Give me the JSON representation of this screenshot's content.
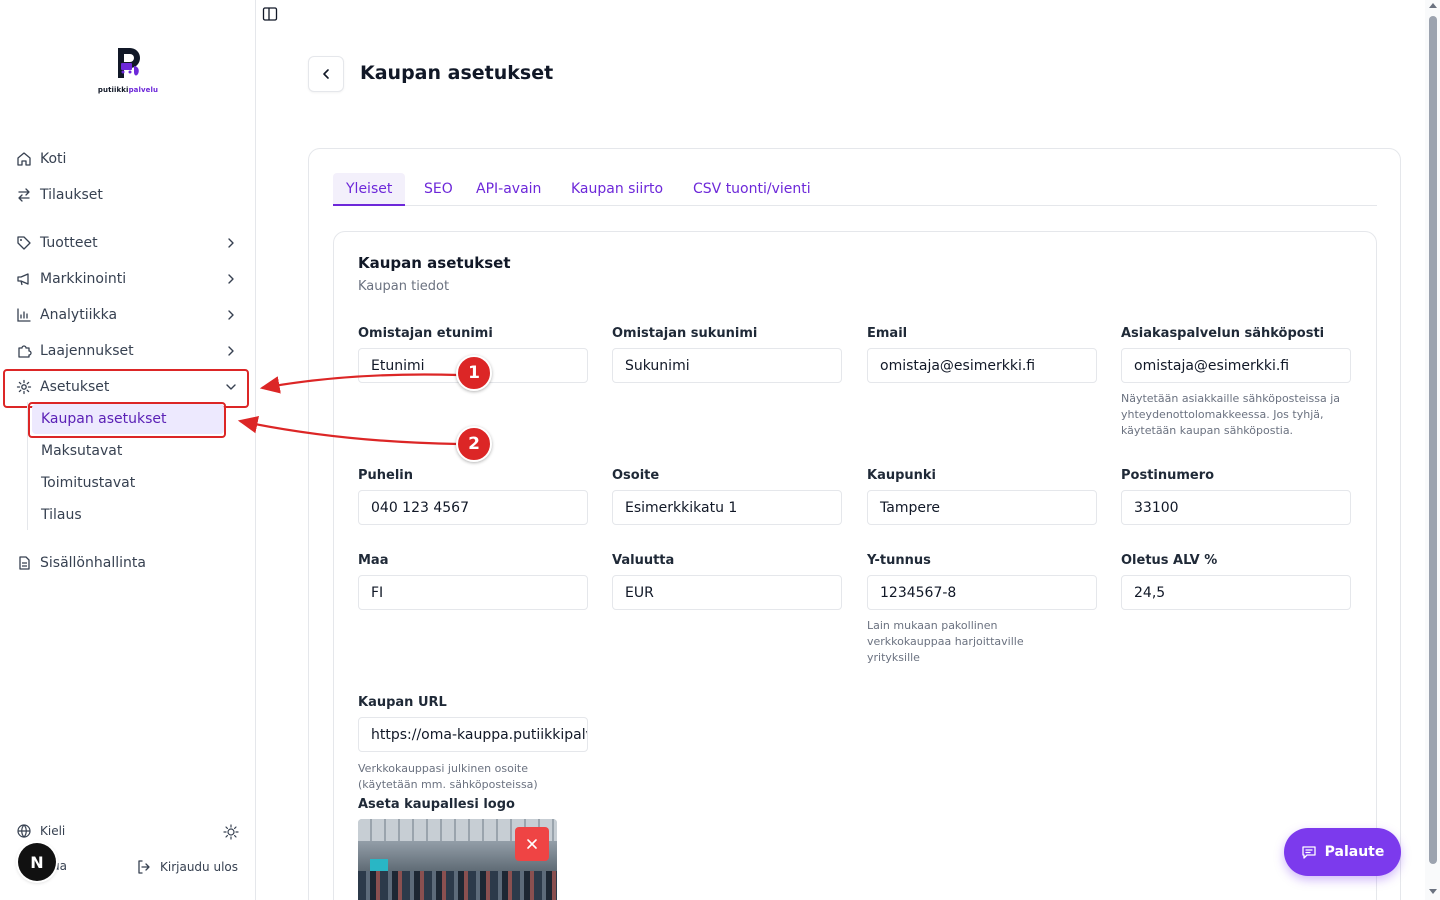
{
  "brand": {
    "name_prefix": "putiikki",
    "name_suffix": "palvelu",
    "accent": "#6d28d9"
  },
  "sidebar": {
    "items": [
      {
        "label": "Koti",
        "icon": "home-icon"
      },
      {
        "label": "Tilaukset",
        "icon": "arrows-icon"
      },
      {
        "label": "Tuotteet",
        "icon": "tag-icon"
      },
      {
        "label": "Markkinointi",
        "icon": "megaphone-icon"
      },
      {
        "label": "Analytiikka",
        "icon": "chart-icon"
      },
      {
        "label": "Laajennukset",
        "icon": "puzzle-icon"
      },
      {
        "label": "Asetukset",
        "icon": "gear-icon"
      },
      {
        "label": "Sisällönhallinta",
        "icon": "file-icon"
      }
    ],
    "sub_items": [
      {
        "label": "Kaupan asetukset",
        "active": true
      },
      {
        "label": "Maksutavat"
      },
      {
        "label": "Toimitustavat"
      },
      {
        "label": "Tilaus"
      }
    ],
    "language_label": "Kieli",
    "avatar_letter": "N",
    "user_name_fragment": "ua",
    "logout_label": "Kirjaudu ulos"
  },
  "page": {
    "title": "Kaupan asetukset"
  },
  "tabs": [
    "Yleiset",
    "SEO",
    "API-avain",
    "Kaupan siirto",
    "CSV tuonti/vienti"
  ],
  "section": {
    "title": "Kaupan asetukset",
    "subtitle": "Kaupan tiedot"
  },
  "fields": {
    "first_name": {
      "label": "Omistajan etunimi",
      "value": "Etunimi"
    },
    "last_name": {
      "label": "Omistajan sukunimi",
      "value": "Sukunimi"
    },
    "email": {
      "label": "Email",
      "value": "omistaja@esimerkki.fi"
    },
    "support_email": {
      "label": "Asiakaspalvelun sähköposti",
      "value": "omistaja@esimerkki.fi",
      "help": "Näytetään asiakkaille sähköposteissa ja yhteydenottolomakkeessa. Jos tyhjä, käytetään kaupan sähköpostia."
    },
    "phone": {
      "label": "Puhelin",
      "value": "040 123 4567"
    },
    "address": {
      "label": "Osoite",
      "value": "Esimerkkikatu 1"
    },
    "city": {
      "label": "Kaupunki",
      "value": "Tampere"
    },
    "postal_code": {
      "label": "Postinumero",
      "value": "33100"
    },
    "country": {
      "label": "Maa",
      "value": "FI"
    },
    "currency": {
      "label": "Valuutta",
      "value": "EUR"
    },
    "business_id": {
      "label": "Y-tunnus",
      "value": "1234567-8",
      "help": "Lain mukaan pakollinen verkkokauppaa harjoittaville yrityksille"
    },
    "vat": {
      "label": "Oletus ALV %",
      "value": "24,5"
    },
    "store_url": {
      "label": "Kaupan URL",
      "value": "https://oma-kauppa.putiikkipalvelu.fi",
      "help": "Verkkokauppasi julkinen osoite (käytetään mm. sähköposteissa)"
    }
  },
  "logo_upload": {
    "label": "Aseta kaupallesi logo"
  },
  "annotations": {
    "badge1": "1",
    "badge2": "2",
    "color": "#dc2626"
  },
  "feedback": {
    "label": "Palaute"
  }
}
